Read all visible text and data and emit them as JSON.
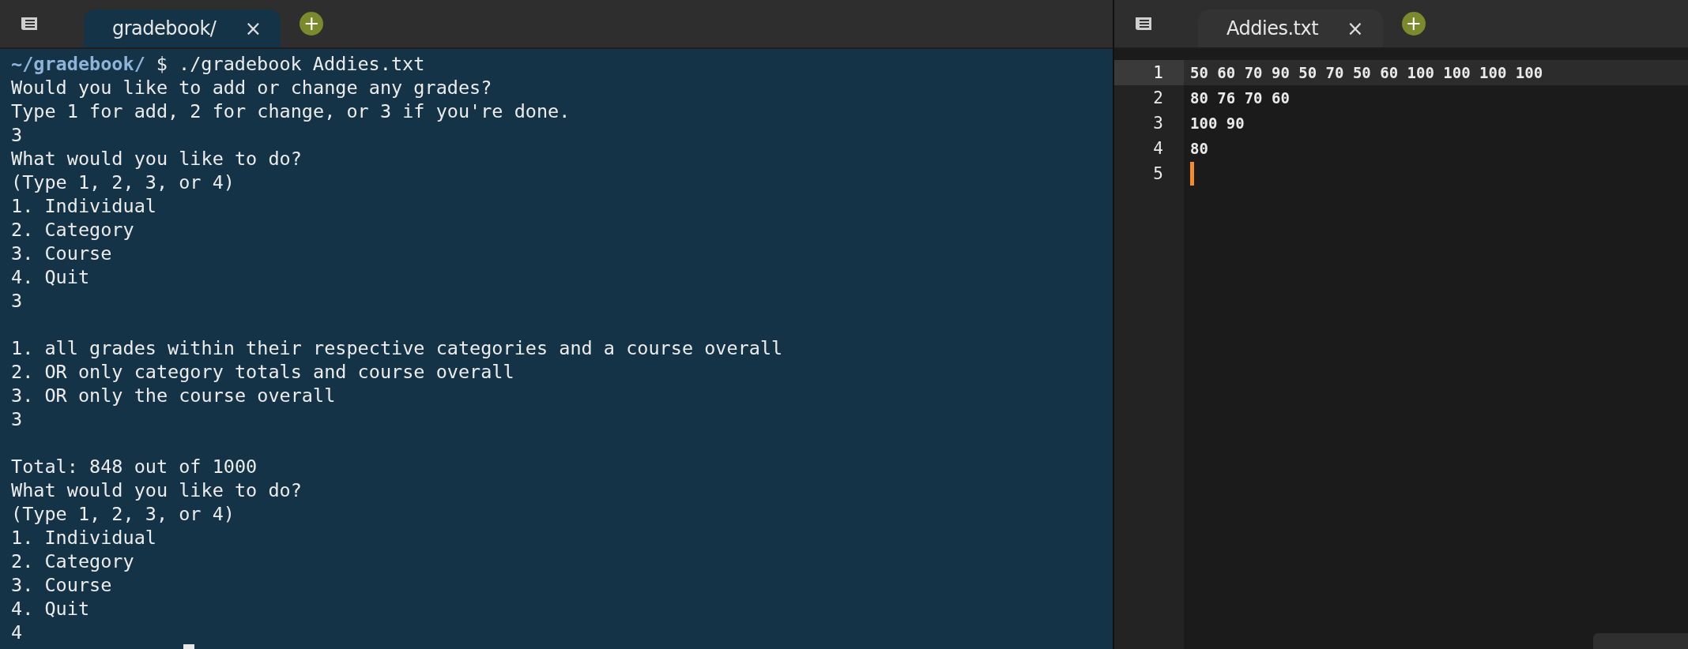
{
  "terminal": {
    "tab": {
      "label": "gradebook/",
      "selected": true,
      "close": "×"
    },
    "add_tab": "+",
    "lines": [
      {
        "kind": "prompt",
        "path": "~/gradebook/",
        "command": "$ ./gradebook Addies.txt"
      },
      {
        "kind": "output",
        "text": "Would you like to add or change any grades?"
      },
      {
        "kind": "output",
        "text": "Type 1 for add, 2 for change, or 3 if you're done."
      },
      {
        "kind": "output",
        "text": "3"
      },
      {
        "kind": "output",
        "text": "What would you like to do?"
      },
      {
        "kind": "output",
        "text": "(Type 1, 2, 3, or 4)"
      },
      {
        "kind": "output",
        "text": "1. Individual"
      },
      {
        "kind": "output",
        "text": "2. Category"
      },
      {
        "kind": "output",
        "text": "3. Course"
      },
      {
        "kind": "output",
        "text": "4. Quit"
      },
      {
        "kind": "output",
        "text": "3"
      },
      {
        "kind": "blank"
      },
      {
        "kind": "output",
        "text": "1. all grades within their respective categories and a course overall"
      },
      {
        "kind": "output",
        "text": "2. OR only category totals and course overall"
      },
      {
        "kind": "output",
        "text": "3. OR only the course overall"
      },
      {
        "kind": "output",
        "text": "3"
      },
      {
        "kind": "blank"
      },
      {
        "kind": "output",
        "text": "Total: 848 out of 1000"
      },
      {
        "kind": "output",
        "text": "What would you like to do?"
      },
      {
        "kind": "output",
        "text": "(Type 1, 2, 3, or 4)"
      },
      {
        "kind": "output",
        "text": "1. Individual"
      },
      {
        "kind": "output",
        "text": "2. Category"
      },
      {
        "kind": "output",
        "text": "3. Course"
      },
      {
        "kind": "output",
        "text": "4. Quit"
      },
      {
        "kind": "output",
        "text": "4"
      },
      {
        "kind": "cursor"
      }
    ]
  },
  "editor": {
    "tab": {
      "label": "Addies.txt",
      "selected": true,
      "close": "×"
    },
    "add_tab": "+",
    "lines": [
      {
        "number": "1",
        "text": "50 60 70 90 50 70 50 60 100 100 100 100",
        "highlighted": true,
        "cursor": false
      },
      {
        "number": "2",
        "text": "80 76 70 60",
        "highlighted": false,
        "cursor": false
      },
      {
        "number": "3",
        "text": "100 90",
        "highlighted": false,
        "cursor": false
      },
      {
        "number": "4",
        "text": "80",
        "highlighted": false,
        "cursor": false
      },
      {
        "number": "5",
        "highlighted": false,
        "cursor": true
      }
    ]
  }
}
